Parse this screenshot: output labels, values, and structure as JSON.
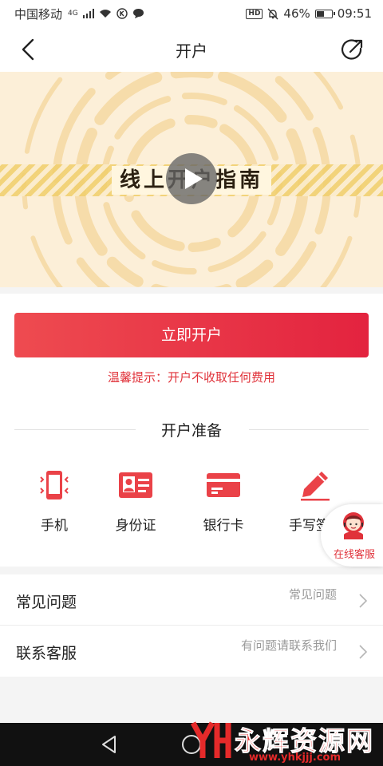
{
  "status_bar": {
    "carrier": "中国移动",
    "network": "4G",
    "hd": "HD",
    "battery": "46%",
    "time": "09:51"
  },
  "header": {
    "title": "开户"
  },
  "banner": {
    "label": "线上开户指南"
  },
  "main": {
    "open_button": "立即开户",
    "tip": "温馨提示：开户不收取任何费用",
    "prep_title": "开户准备",
    "prep_items": [
      {
        "label": "手机",
        "icon": "phone-icon"
      },
      {
        "label": "身份证",
        "icon": "id-card-icon"
      },
      {
        "label": "银行卡",
        "icon": "bank-card-icon"
      },
      {
        "label": "手写签名",
        "icon": "pen-icon"
      }
    ]
  },
  "online_service": {
    "label": "在线客服"
  },
  "list": [
    {
      "title": "常见问题",
      "hint": "常见问题"
    },
    {
      "title": "联系客服",
      "hint": "有问题请联系我们"
    }
  ],
  "watermark": {
    "text": "永辉资源网",
    "url": "www.yhkjjj.com"
  },
  "colors": {
    "accent": "#e3233f",
    "banner_bg": "#fcefd8",
    "stripe": "#f0ce6a",
    "nav_bar": "#111111"
  }
}
